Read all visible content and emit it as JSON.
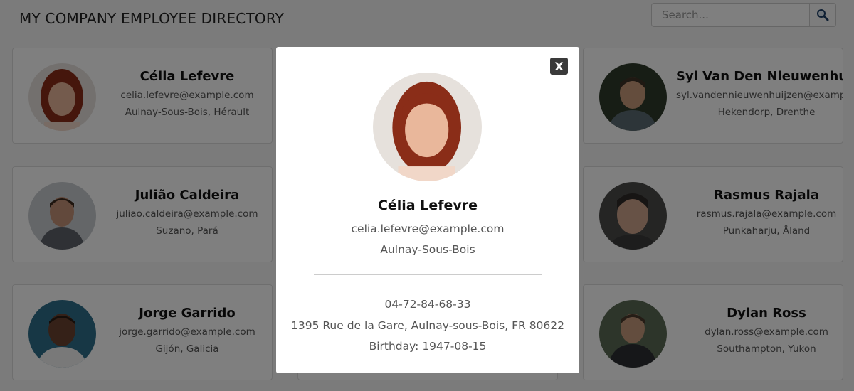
{
  "header": {
    "title": "MY COMPANY EMPLOYEE DIRECTORY",
    "search_placeholder": "Search...",
    "search_icon": "search-icon"
  },
  "employees": [
    {
      "name": "Célia Lefevre",
      "email": "celia.lefevre@example.com",
      "location": "Aulnay-Sous-Bois, Hérault",
      "avatar": {
        "skin": "#e9b79b",
        "hair": "#8a2d18",
        "shirt": "#f1d7c8",
        "bg": "#e6e1dc"
      }
    },
    {
      "name": "Syl Van Den Nieuwenhuijzen",
      "email": "syl.vandennieuwenhuijzen@example.com",
      "location": "Hekendorp, Drenthe",
      "avatar": {
        "skin": "#c99a7b",
        "hair": "#3e3226",
        "shirt": "#5b6b73",
        "bg": "#2f3b2a"
      }
    },
    {
      "name": "Julião Caldeira",
      "email": "juliao.caldeira@example.com",
      "location": "Suzano, Pará",
      "avatar": {
        "skin": "#c59378",
        "hair": "#3d2b1f",
        "shirt": "#5e636a",
        "bg": "#c8ccd0"
      }
    },
    {
      "name": "Rasmus Rajala",
      "email": "rasmus.rajala@example.com",
      "location": "Punkaharju, Åland",
      "avatar": {
        "skin": "#cfa48c",
        "hair": "#2e2a28",
        "shirt": "#3a3a3a",
        "bg": "#4a4a48"
      }
    },
    {
      "name": "Jorge Garrido",
      "email": "jorge.garrido@example.com",
      "location": "Gijón, Galicia",
      "avatar": {
        "skin": "#6b4330",
        "hair": "#2a1c14",
        "shirt": "#f3f3f3",
        "bg": "#2f6f8a"
      }
    },
    {
      "name": "Dylan Ross",
      "email": "dylan.ross@example.com",
      "location": "Southampton, Yukon",
      "avatar": {
        "skin": "#c79a7c",
        "hair": "#4a3a2c",
        "shirt": "#2c2f33",
        "bg": "#5a6a55"
      }
    }
  ],
  "modal": {
    "close_label": "X",
    "name": "Célia Lefevre",
    "email": "celia.lefevre@example.com",
    "city": "Aulnay-Sous-Bois",
    "phone": "04-72-84-68-33",
    "address": "1395 Rue de la Gare, Aulnay-sous-Bois, FR 80622",
    "birthday": "Birthday: 1947-08-15"
  }
}
